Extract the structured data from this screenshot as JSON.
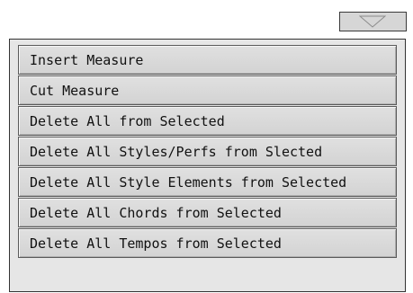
{
  "dropdown": {
    "icon": "chevron-down-icon"
  },
  "menu": {
    "items": [
      {
        "label": "Insert Measure"
      },
      {
        "label": "Cut Measure"
      },
      {
        "label": "Delete All from Selected"
      },
      {
        "label": "Delete All Styles/Perfs from Slected"
      },
      {
        "label": "Delete All Style Elements from Selected"
      },
      {
        "label": "Delete All Chords from Selected"
      },
      {
        "label": "Delete All Tempos from Selected"
      }
    ]
  }
}
